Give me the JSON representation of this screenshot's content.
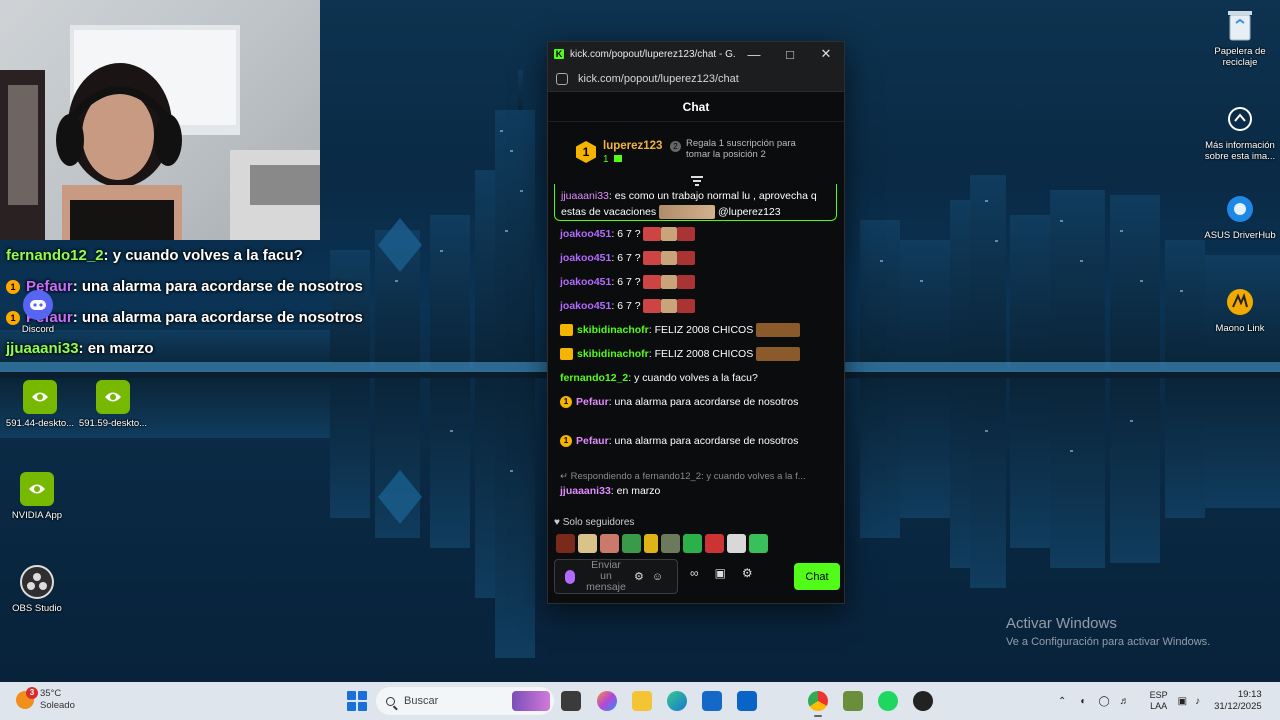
{
  "stream_overlay": {
    "lines": [
      {
        "user": "fernando12_2",
        "text": ": y cuando volves a la facu?"
      },
      {
        "user": "Pefaur",
        "text": ": una alarma para acordarse de nosotros"
      },
      {
        "user": "Pefaur",
        "text": ": una alarma para acordarse de nosotros"
      },
      {
        "user": "jjuaaani33",
        "text": ": en marzo"
      }
    ]
  },
  "desktop_icons": {
    "recycle": "Papelera de reciclaje",
    "info": "Más información sobre esta ima...",
    "asus": "ASUS DriverHub",
    "maono": "Maono Link",
    "discord": "Discord",
    "nvidia1": "591.44-deskto...",
    "nvidia2": "591.59-deskto...",
    "nvidia_app": "NVIDIA App",
    "obs": "OBS Studio"
  },
  "chat_window": {
    "title": "kick.com/popout/luperez123/chat - G...",
    "url": "kick.com/popout/luperez123/chat",
    "header": "Chat",
    "leaderboard": {
      "rank": "1",
      "name": "luperez123",
      "count": "1",
      "gift_rank": "2",
      "gift_text": "Regala 1 suscripción para tomar la posición 2"
    },
    "pinned": {
      "user": "jjuaaani33",
      "text": ": es como un trabajo normal lu , aprovecha q estas de vacaciones",
      "mention": "@luperez123"
    },
    "messages": [
      {
        "user": "joakoo451",
        "text": ": 6 7 ?"
      },
      {
        "user": "joakoo451",
        "text": ": 6 7 ?"
      },
      {
        "user": "joakoo451",
        "text": ": 6 7 ?"
      },
      {
        "user": "joakoo451",
        "text": ": 6 7 ?"
      },
      {
        "user": "skibidinachofr",
        "text": ": FELIZ 2008 CHICOS"
      },
      {
        "user": "skibidinachofr",
        "text": ": FELIZ 2008 CHICOS"
      },
      {
        "user": "fernando12_2",
        "text": ": y cuando volves a la facu?"
      },
      {
        "user": "Pefaur",
        "text": ": una alarma para acordarse de nosotros"
      },
      {
        "user": "Pefaur",
        "text": ": una alarma para acordarse de nosotros"
      }
    ],
    "reply": {
      "context": "Respondiendo a fernando12_2: y cuando volves a la f...",
      "user": "jjuaaani33",
      "text": ": en marzo"
    },
    "follower_note": "Solo seguidores",
    "input_placeholder": "Enviar un mensaje",
    "send_label": "Chat"
  },
  "activate_windows": {
    "title": "Activar Windows",
    "subtitle": "Ve a Configuración para activar Windows."
  },
  "taskbar": {
    "weather_temp": "35°C",
    "weather_desc": "Soleado",
    "weather_badge": "3",
    "search_placeholder": "Buscar",
    "lang_1": "ESP",
    "lang_2": "LAA",
    "time": "19:13",
    "date": "31/12/2025"
  }
}
